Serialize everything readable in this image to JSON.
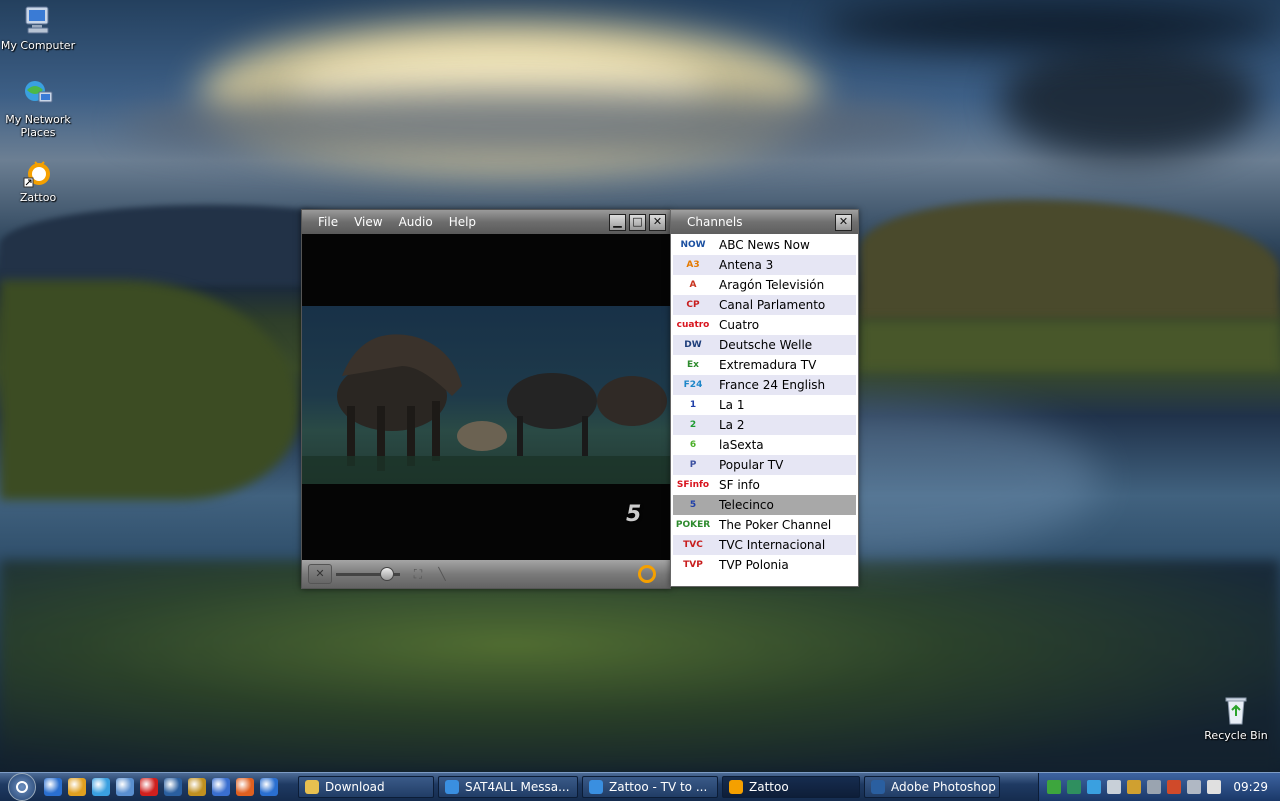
{
  "desktop": {
    "icons": [
      {
        "label": "My Computer",
        "icon": "computer-icon"
      },
      {
        "label": "My Network\nPlaces",
        "icon": "network-icon"
      },
      {
        "label": "Zattoo",
        "icon": "zattoo-icon"
      },
      {
        "label": "Recycle Bin",
        "icon": "recycle-bin-icon"
      }
    ]
  },
  "player": {
    "menu": [
      "File",
      "View",
      "Audio",
      "Help"
    ],
    "volume_fraction": 0.85,
    "channel_watermark": "5"
  },
  "channels_window": {
    "title": "Channels",
    "selected_index": 13,
    "items": [
      {
        "name": "ABC News Now",
        "logo_text": "NOW",
        "logo_color": "#1a4fa0"
      },
      {
        "name": "Antena 3",
        "logo_text": "A3",
        "logo_color": "#e57a00"
      },
      {
        "name": "Aragón Televisión",
        "logo_text": "A",
        "logo_color": "#c8321e"
      },
      {
        "name": "Canal Parlamento",
        "logo_text": "CP",
        "logo_color": "#c81e1e"
      },
      {
        "name": "Cuatro",
        "logo_text": "cuatro",
        "logo_color": "#d8141e"
      },
      {
        "name": "Deutsche Welle",
        "logo_text": "DW",
        "logo_color": "#1d3d7a"
      },
      {
        "name": "Extremadura TV",
        "logo_text": "Ex",
        "logo_color": "#2e8b2e"
      },
      {
        "name": "France 24 English",
        "logo_text": "F24",
        "logo_color": "#1d86c8"
      },
      {
        "name": "La 1",
        "logo_text": "1",
        "logo_color": "#1f3fa8"
      },
      {
        "name": "La 2",
        "logo_text": "2",
        "logo_color": "#1e9b32"
      },
      {
        "name": "laSexta",
        "logo_text": "6",
        "logo_color": "#4caf2a"
      },
      {
        "name": "Popular TV",
        "logo_text": "P",
        "logo_color": "#3b4fa0"
      },
      {
        "name": "SF info",
        "logo_text": "SFinfo",
        "logo_color": "#d8141e"
      },
      {
        "name": "Telecinco",
        "logo_text": "5",
        "logo_color": "#1f3fa8"
      },
      {
        "name": "The Poker Channel",
        "logo_text": "POKER",
        "logo_color": "#2e8b2e"
      },
      {
        "name": "TVC Internacional",
        "logo_text": "TVC",
        "logo_color": "#c81e1e"
      },
      {
        "name": "TVP Polonia",
        "logo_text": "TVP",
        "logo_color": "#c81e1e"
      }
    ]
  },
  "taskbar": {
    "quick_launch": [
      "ie-icon",
      "outlook-icon",
      "search-icon",
      "explorer-icon",
      "opera-icon",
      "arrow-icon",
      "winrar-icon",
      "media-player-icon",
      "firefox-icon",
      "ie-icon-2"
    ],
    "tasks": [
      {
        "label": "Download",
        "icon": "folder-icon",
        "active": false
      },
      {
        "label": "SAT4ALL Messa...",
        "icon": "ie-icon",
        "active": false
      },
      {
        "label": "Zattoo - TV to ...",
        "icon": "ie-icon",
        "active": false
      },
      {
        "label": "Zattoo",
        "icon": "zattoo-icon",
        "active": true
      },
      {
        "label": "Adobe Photoshop",
        "icon": "photoshop-icon",
        "active": false
      }
    ],
    "clock": "09:29"
  }
}
